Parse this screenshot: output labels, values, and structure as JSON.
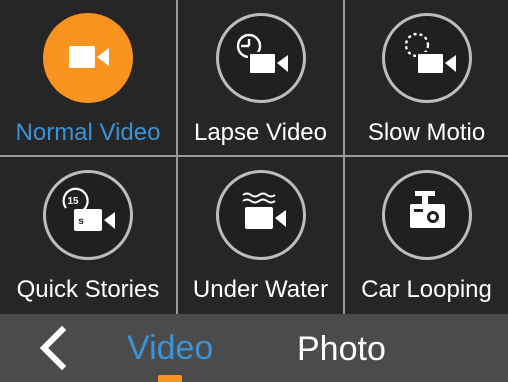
{
  "modes": [
    {
      "label": "Normal Video",
      "icon": "video-camera-icon",
      "active": true
    },
    {
      "label": "Lapse Video",
      "icon": "timelapse-video-icon",
      "active": false
    },
    {
      "label": "Slow Motio",
      "icon": "slow-motion-video-icon",
      "active": false
    },
    {
      "label": "Quick Stories",
      "icon": "quick-stories-15s-icon",
      "active": false,
      "badge": "15",
      "badge_unit": "s"
    },
    {
      "label": "Under Water",
      "icon": "underwater-video-icon",
      "active": false
    },
    {
      "label": "Car Looping",
      "icon": "dashcam-icon",
      "active": false
    }
  ],
  "bottom_bar": {
    "back_icon": "chevron-left-icon",
    "tabs": [
      {
        "label": "Video",
        "active": true
      },
      {
        "label": "Photo",
        "active": false
      }
    ]
  },
  "colors": {
    "accent_orange": "#f7931e",
    "accent_blue": "#3a93d8",
    "tile_bg": "#262626",
    "bottom_bar_bg": "#4b4b4b"
  }
}
